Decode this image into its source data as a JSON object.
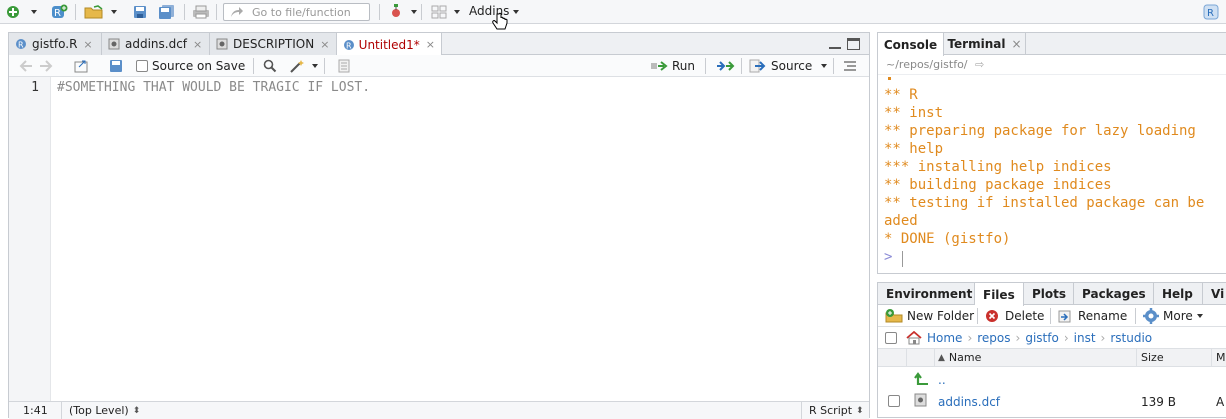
{
  "toolbar": {
    "goto_placeholder": "Go to file/function",
    "addins_label": "Addins"
  },
  "source": {
    "tabs": [
      {
        "label": "gistfo.R",
        "close": "×"
      },
      {
        "label": "addins.dcf",
        "close": "×"
      },
      {
        "label": "DESCRIPTION",
        "close": "×"
      },
      {
        "label": "Untitled1*",
        "close": "×"
      }
    ],
    "source_on_save": "Source on Save",
    "run_label": "Run",
    "source_label": "Source",
    "line_number": "1",
    "code_line": "#SOMETHING THAT WOULD BE TRAGIC IF LOST.",
    "status_position": "1:41",
    "status_scope": "(Top Level)",
    "status_type": "R Script"
  },
  "console": {
    "tab_console": "Console",
    "tab_terminal": "Terminal",
    "terminal_close": "×",
    "path": "~/repos/gistfo/",
    "lines": [
      "** R",
      "** inst",
      "** preparing package for lazy loading",
      "** help",
      "*** installing help indices",
      "** building package indices",
      "** testing if installed package can be",
      "aded",
      "* DONE (gistfo)"
    ],
    "prompt": ">"
  },
  "files": {
    "tabs": [
      "Environment",
      "Files",
      "Plots",
      "Packages",
      "Help",
      "Vi"
    ],
    "new_folder": "New Folder",
    "delete": "Delete",
    "rename": "Rename",
    "more": "More",
    "breadcrumbs": [
      "Home",
      "repos",
      "gistfo",
      "inst",
      "rstudio"
    ],
    "col_name": "Name",
    "col_size": "Size",
    "col_modified": "M",
    "parent": "..",
    "rows": [
      {
        "name": "addins.dcf",
        "size": "139 B",
        "modified": "A"
      }
    ]
  },
  "colors": {
    "accent": "#2a6ebb",
    "console_output": "#e08a1e",
    "unsaved_tab": "#b00000"
  }
}
